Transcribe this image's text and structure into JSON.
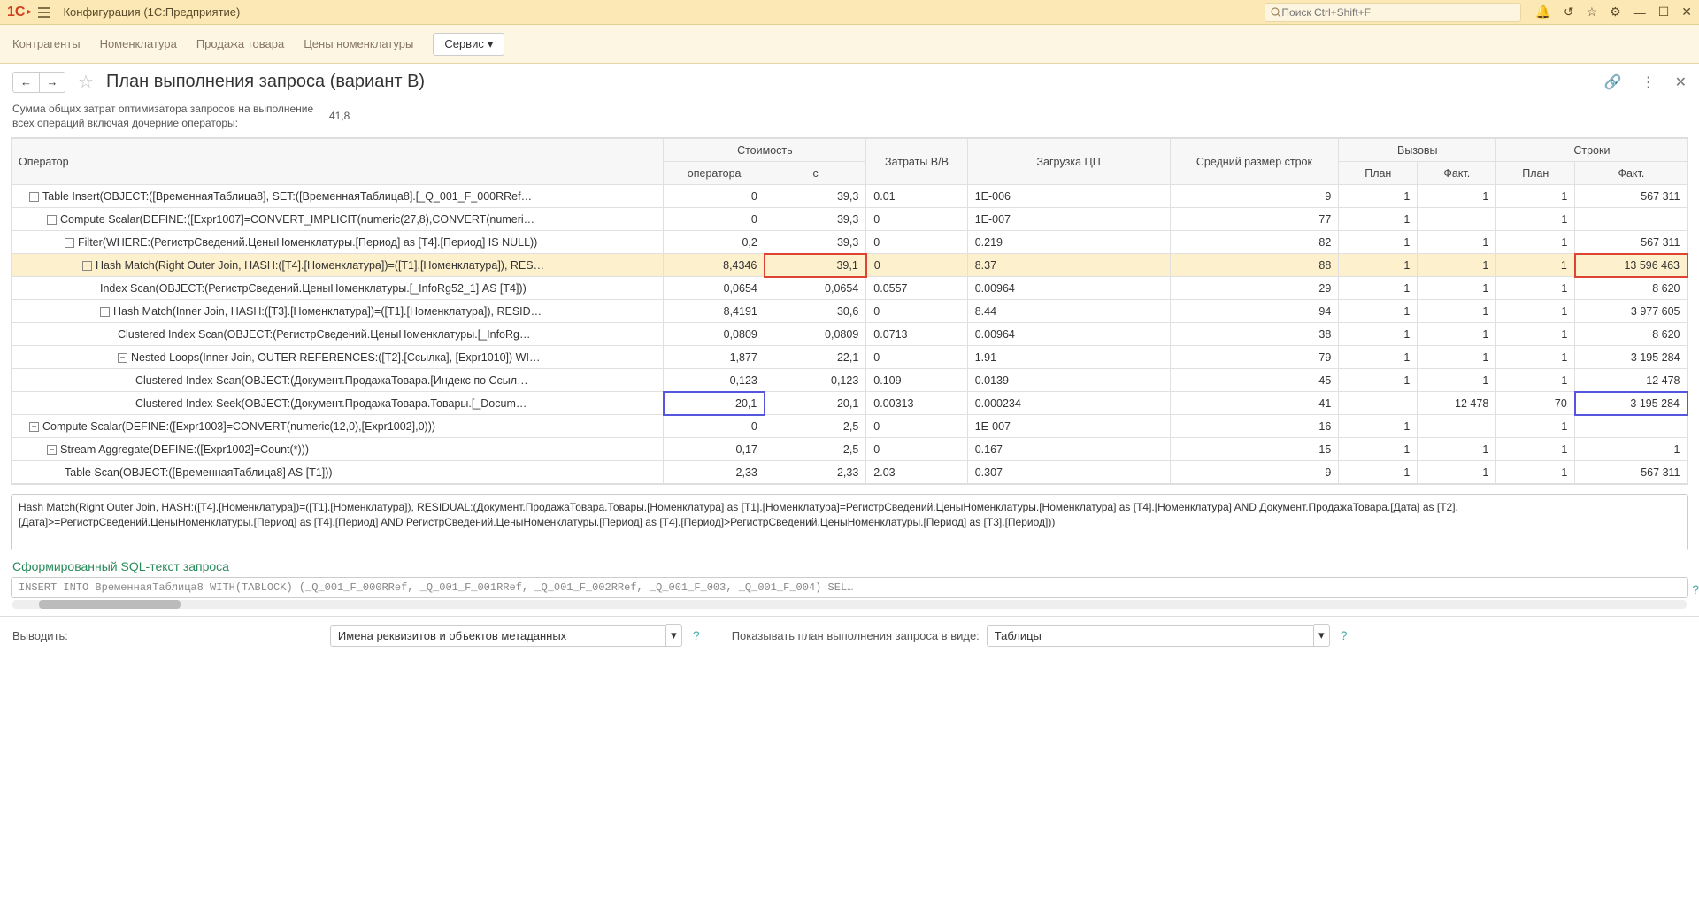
{
  "titlebar": {
    "title": "Конфигурация (1С:Предприятие)",
    "search_placeholder": "Поиск Ctrl+Shift+F"
  },
  "menubar": {
    "items": [
      "Контрагенты",
      "Номенклатура",
      "Продажа товара",
      "Цены номенклатуры"
    ],
    "service": "Сервис"
  },
  "page": {
    "title": "План выполнения запроса (вариант В)"
  },
  "summary": {
    "label": "Сумма общих затрат оптимизатора запросов на выполнение всех операций включая дочерние операторы:",
    "value": "41,8"
  },
  "table": {
    "headers": {
      "operator": "Оператор",
      "cost": "Стоимость",
      "cost_op": "оператора",
      "cost_c": "с",
      "io": "Затраты В/В",
      "cpu": "Загрузка ЦП",
      "rowsize": "Средний размер строк",
      "calls": "Вызовы",
      "plan": "План",
      "fact": "Факт.",
      "rows": "Строки"
    },
    "rows": [
      {
        "indent": 0,
        "toggle": true,
        "op": "Table Insert(OBJECT:([ВременнаяТаблица8], SET:([ВременнаяТаблица8].[_Q_001_F_000RRef…",
        "cost_op": "0",
        "cost_c": "39,3",
        "io": "0.01",
        "cpu": "1E-006",
        "rowsize": "9",
        "call_plan": "1",
        "call_fact": "1",
        "row_plan": "1",
        "row_fact": "567 311"
      },
      {
        "indent": 1,
        "toggle": true,
        "op": "Compute Scalar(DEFINE:([Expr1007]=CONVERT_IMPLICIT(numeric(27,8),CONVERT(numeri…",
        "cost_op": "0",
        "cost_c": "39,3",
        "io": "0",
        "cpu": "1E-007",
        "rowsize": "77",
        "call_plan": "1",
        "call_fact": "",
        "row_plan": "1",
        "row_fact": ""
      },
      {
        "indent": 2,
        "toggle": true,
        "op": "Filter(WHERE:(РегистрСведений.ЦеныНоменклатуры.[Период] as [T4].[Период] IS NULL))",
        "cost_op": "0,2",
        "cost_c": "39,3",
        "io": "0",
        "cpu": "0.219",
        "rowsize": "82",
        "call_plan": "1",
        "call_fact": "1",
        "row_plan": "1",
        "row_fact": "567 311"
      },
      {
        "indent": 3,
        "toggle": true,
        "selected": true,
        "op": "Hash Match(Right Outer Join, HASH:([T4].[Номенклатура])=([T1].[Номенклатура]), RES…",
        "cost_op": "8,4346",
        "cost_c": "39,1",
        "cost_c_red": true,
        "io": "0",
        "cpu": "8.37",
        "rowsize": "88",
        "call_plan": "1",
        "call_fact": "1",
        "row_plan": "1",
        "row_fact": "13 596 463",
        "row_fact_red": true
      },
      {
        "indent": 4,
        "op": "Index Scan(OBJECT:(РегистрСведений.ЦеныНоменклатуры.[_InfoRg52_1] AS [T4]))",
        "cost_op": "0,0654",
        "cost_c": "0,0654",
        "io": "0.0557",
        "cpu": "0.00964",
        "rowsize": "29",
        "call_plan": "1",
        "call_fact": "1",
        "row_plan": "1",
        "row_fact": "8 620"
      },
      {
        "indent": 4,
        "toggle": true,
        "op": "Hash Match(Inner Join, HASH:([T3].[Номенклатура])=([T1].[Номенклатура]), RESID…",
        "cost_op": "8,4191",
        "cost_c": "30,6",
        "io": "0",
        "cpu": "8.44",
        "rowsize": "94",
        "call_plan": "1",
        "call_fact": "1",
        "row_plan": "1",
        "row_fact": "3 977 605"
      },
      {
        "indent": 5,
        "op": "Clustered Index Scan(OBJECT:(РегистрСведений.ЦеныНоменклатуры.[_InfoRg…",
        "cost_op": "0,0809",
        "cost_c": "0,0809",
        "io": "0.0713",
        "cpu": "0.00964",
        "rowsize": "38",
        "call_plan": "1",
        "call_fact": "1",
        "row_plan": "1",
        "row_fact": "8 620"
      },
      {
        "indent": 5,
        "toggle": true,
        "op": "Nested Loops(Inner Join, OUTER REFERENCES:([T2].[Ссылка], [Expr1010]) WI…",
        "cost_op": "1,877",
        "cost_c": "22,1",
        "io": "0",
        "cpu": "1.91",
        "rowsize": "79",
        "call_plan": "1",
        "call_fact": "1",
        "row_plan": "1",
        "row_fact": "3 195 284"
      },
      {
        "indent": 6,
        "op": "Clustered Index Scan(OBJECT:(Документ.ПродажаТовара.[Индекс по Ссыл…",
        "cost_op": "0,123",
        "cost_c": "0,123",
        "io": "0.109",
        "cpu": "0.0139",
        "rowsize": "45",
        "call_plan": "1",
        "call_fact": "1",
        "row_plan": "1",
        "row_fact": "12 478"
      },
      {
        "indent": 6,
        "op": "Clustered Index Seek(OBJECT:(Документ.ПродажаТовара.Товары.[_Docum…",
        "cost_op": "20,1",
        "cost_op_blue": true,
        "cost_c": "20,1",
        "io": "0.00313",
        "cpu": "0.000234",
        "rowsize": "41",
        "call_plan": "",
        "call_fact": "12 478",
        "row_plan": "70",
        "row_fact": "3 195 284",
        "row_fact_blue": true
      },
      {
        "indent": 0,
        "toggle": true,
        "op": "Compute Scalar(DEFINE:([Expr1003]=CONVERT(numeric(12,0),[Expr1002],0)))",
        "cost_op": "0",
        "cost_c": "2,5",
        "io": "0",
        "cpu": "1E-007",
        "rowsize": "16",
        "call_plan": "1",
        "call_fact": "",
        "row_plan": "1",
        "row_fact": ""
      },
      {
        "indent": 1,
        "toggle": true,
        "op": "Stream Aggregate(DEFINE:([Expr1002]=Count(*)))",
        "cost_op": "0,17",
        "cost_c": "2,5",
        "io": "0",
        "cpu": "0.167",
        "rowsize": "15",
        "call_plan": "1",
        "call_fact": "1",
        "row_plan": "1",
        "row_fact": "1"
      },
      {
        "indent": 2,
        "op": "Table Scan(OBJECT:([ВременнаяТаблица8] AS [T1]))",
        "cost_op": "2,33",
        "cost_c": "2,33",
        "io": "2.03",
        "cpu": "0.307",
        "rowsize": "9",
        "call_plan": "1",
        "call_fact": "1",
        "row_plan": "1",
        "row_fact": "567 311"
      }
    ]
  },
  "detail": {
    "text": "Hash Match(Right Outer Join, HASH:([T4].[Номенклатура])=([T1].[Номенклатура]), RESIDUAL:(Документ.ПродажаТовара.Товары.[Номенклатура] as [T1].[Номенклатура]=РегистрСведений.ЦеныНоменклатуры.[Номенклатура] as [T4].[Номенклатура] AND Документ.ПродажаТовара.[Дата] as [T2].[Дата]>=РегистрСведений.ЦеныНоменклатуры.[Период] as [T4].[Период] AND РегистрСведений.ЦеныНоменклатуры.[Период] as [T4].[Период]>РегистрСведений.ЦеныНоменклатуры.[Период] as [T3].[Период]))"
  },
  "sql": {
    "header": "Сформированный SQL-текст запроса",
    "text": "INSERT INTO ВременнаяТаблица8 WITH(TABLOCK) (_Q_001_F_000RRef, _Q_001_F_001RRef, _Q_001_F_002RRef, _Q_001_F_003, _Q_001_F_004) SEL…"
  },
  "footer": {
    "output_label": "Выводить:",
    "output_value": "Имена реквизитов и объектов метаданных",
    "show_label": "Показывать план выполнения запроса в виде:",
    "show_value": "Таблицы"
  }
}
